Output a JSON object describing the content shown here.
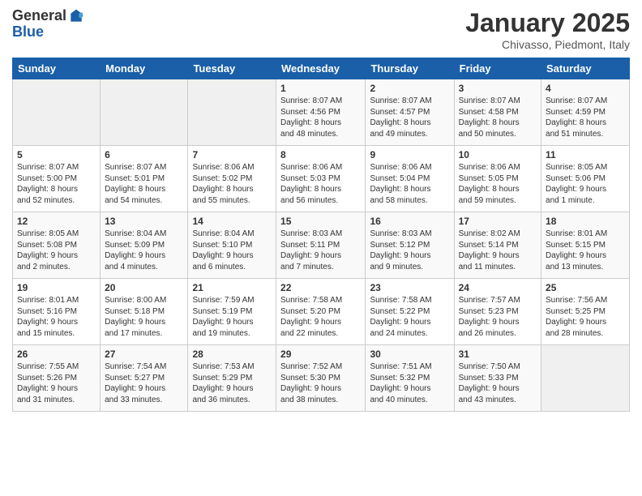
{
  "header": {
    "logo_general": "General",
    "logo_blue": "Blue",
    "month_title": "January 2025",
    "location": "Chivasso, Piedmont, Italy"
  },
  "weekdays": [
    "Sunday",
    "Monday",
    "Tuesday",
    "Wednesday",
    "Thursday",
    "Friday",
    "Saturday"
  ],
  "weeks": [
    [
      {
        "day": "",
        "info": ""
      },
      {
        "day": "",
        "info": ""
      },
      {
        "day": "",
        "info": ""
      },
      {
        "day": "1",
        "info": "Sunrise: 8:07 AM\nSunset: 4:56 PM\nDaylight: 8 hours\nand 48 minutes."
      },
      {
        "day": "2",
        "info": "Sunrise: 8:07 AM\nSunset: 4:57 PM\nDaylight: 8 hours\nand 49 minutes."
      },
      {
        "day": "3",
        "info": "Sunrise: 8:07 AM\nSunset: 4:58 PM\nDaylight: 8 hours\nand 50 minutes."
      },
      {
        "day": "4",
        "info": "Sunrise: 8:07 AM\nSunset: 4:59 PM\nDaylight: 8 hours\nand 51 minutes."
      }
    ],
    [
      {
        "day": "5",
        "info": "Sunrise: 8:07 AM\nSunset: 5:00 PM\nDaylight: 8 hours\nand 52 minutes."
      },
      {
        "day": "6",
        "info": "Sunrise: 8:07 AM\nSunset: 5:01 PM\nDaylight: 8 hours\nand 54 minutes."
      },
      {
        "day": "7",
        "info": "Sunrise: 8:06 AM\nSunset: 5:02 PM\nDaylight: 8 hours\nand 55 minutes."
      },
      {
        "day": "8",
        "info": "Sunrise: 8:06 AM\nSunset: 5:03 PM\nDaylight: 8 hours\nand 56 minutes."
      },
      {
        "day": "9",
        "info": "Sunrise: 8:06 AM\nSunset: 5:04 PM\nDaylight: 8 hours\nand 58 minutes."
      },
      {
        "day": "10",
        "info": "Sunrise: 8:06 AM\nSunset: 5:05 PM\nDaylight: 8 hours\nand 59 minutes."
      },
      {
        "day": "11",
        "info": "Sunrise: 8:05 AM\nSunset: 5:06 PM\nDaylight: 9 hours\nand 1 minute."
      }
    ],
    [
      {
        "day": "12",
        "info": "Sunrise: 8:05 AM\nSunset: 5:08 PM\nDaylight: 9 hours\nand 2 minutes."
      },
      {
        "day": "13",
        "info": "Sunrise: 8:04 AM\nSunset: 5:09 PM\nDaylight: 9 hours\nand 4 minutes."
      },
      {
        "day": "14",
        "info": "Sunrise: 8:04 AM\nSunset: 5:10 PM\nDaylight: 9 hours\nand 6 minutes."
      },
      {
        "day": "15",
        "info": "Sunrise: 8:03 AM\nSunset: 5:11 PM\nDaylight: 9 hours\nand 7 minutes."
      },
      {
        "day": "16",
        "info": "Sunrise: 8:03 AM\nSunset: 5:12 PM\nDaylight: 9 hours\nand 9 minutes."
      },
      {
        "day": "17",
        "info": "Sunrise: 8:02 AM\nSunset: 5:14 PM\nDaylight: 9 hours\nand 11 minutes."
      },
      {
        "day": "18",
        "info": "Sunrise: 8:01 AM\nSunset: 5:15 PM\nDaylight: 9 hours\nand 13 minutes."
      }
    ],
    [
      {
        "day": "19",
        "info": "Sunrise: 8:01 AM\nSunset: 5:16 PM\nDaylight: 9 hours\nand 15 minutes."
      },
      {
        "day": "20",
        "info": "Sunrise: 8:00 AM\nSunset: 5:18 PM\nDaylight: 9 hours\nand 17 minutes."
      },
      {
        "day": "21",
        "info": "Sunrise: 7:59 AM\nSunset: 5:19 PM\nDaylight: 9 hours\nand 19 minutes."
      },
      {
        "day": "22",
        "info": "Sunrise: 7:58 AM\nSunset: 5:20 PM\nDaylight: 9 hours\nand 22 minutes."
      },
      {
        "day": "23",
        "info": "Sunrise: 7:58 AM\nSunset: 5:22 PM\nDaylight: 9 hours\nand 24 minutes."
      },
      {
        "day": "24",
        "info": "Sunrise: 7:57 AM\nSunset: 5:23 PM\nDaylight: 9 hours\nand 26 minutes."
      },
      {
        "day": "25",
        "info": "Sunrise: 7:56 AM\nSunset: 5:25 PM\nDaylight: 9 hours\nand 28 minutes."
      }
    ],
    [
      {
        "day": "26",
        "info": "Sunrise: 7:55 AM\nSunset: 5:26 PM\nDaylight: 9 hours\nand 31 minutes."
      },
      {
        "day": "27",
        "info": "Sunrise: 7:54 AM\nSunset: 5:27 PM\nDaylight: 9 hours\nand 33 minutes."
      },
      {
        "day": "28",
        "info": "Sunrise: 7:53 AM\nSunset: 5:29 PM\nDaylight: 9 hours\nand 36 minutes."
      },
      {
        "day": "29",
        "info": "Sunrise: 7:52 AM\nSunset: 5:30 PM\nDaylight: 9 hours\nand 38 minutes."
      },
      {
        "day": "30",
        "info": "Sunrise: 7:51 AM\nSunset: 5:32 PM\nDaylight: 9 hours\nand 40 minutes."
      },
      {
        "day": "31",
        "info": "Sunrise: 7:50 AM\nSunset: 5:33 PM\nDaylight: 9 hours\nand 43 minutes."
      },
      {
        "day": "",
        "info": ""
      }
    ]
  ]
}
